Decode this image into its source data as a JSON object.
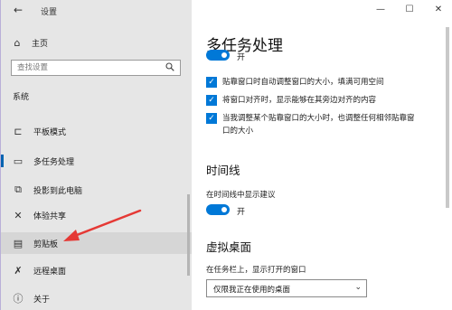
{
  "window": {
    "title": "设置"
  },
  "sidebar": {
    "home_label": "主页",
    "search_placeholder": "查找设置",
    "section_label": "系统",
    "items": [
      {
        "label": "平板模式",
        "icon": "tablet-icon"
      },
      {
        "label": "多任务处理",
        "icon": "multitasking-icon"
      },
      {
        "label": "投影到此电脑",
        "icon": "projecting-icon"
      },
      {
        "label": "体验共享",
        "icon": "shared-experiences-icon"
      },
      {
        "label": "剪贴板",
        "icon": "clipboard-icon"
      },
      {
        "label": "远程桌面",
        "icon": "remote-desktop-icon"
      },
      {
        "label": "关于",
        "icon": "info-icon"
      }
    ],
    "active_item": "多任务处理",
    "hover_item": "剪贴板"
  },
  "content": {
    "title": "多任务处理",
    "snap_toggle_text": "开",
    "checkboxes": [
      {
        "label": "贴靠窗口时自动调整窗口的大小，填满可用空间",
        "checked": true
      },
      {
        "label": "将窗口对齐时，显示能够在其旁边对齐的内容",
        "checked": true
      },
      {
        "label": "当我调整某个贴靠窗口的大小时，也调整任何相邻贴靠窗口的大小",
        "checked": true
      }
    ],
    "timeline": {
      "title": "时间线",
      "label": "在时间线中显示建议",
      "toggle_text": "开"
    },
    "virtual_desktops": {
      "title": "虚拟桌面",
      "label": "在任务栏上，显示打开的窗口",
      "dropdown_value": "仅限我正在使用的桌面"
    }
  },
  "annotation": {
    "color": "#e53935"
  },
  "colors": {
    "accent": "#0078d7",
    "sidebar_bg": "#e6e6e6",
    "background": "#8a7fb8"
  }
}
